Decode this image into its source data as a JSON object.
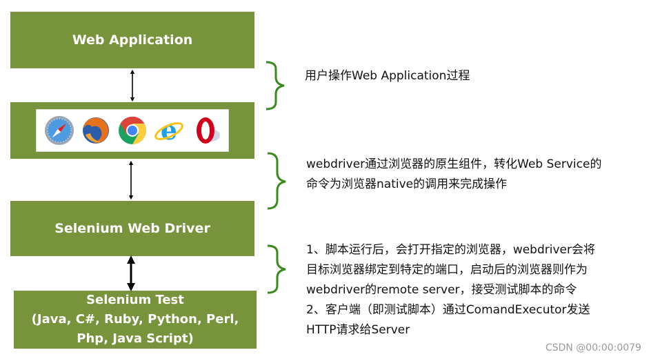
{
  "blocks": {
    "web_application": "Web Application",
    "selenium_web_driver": "Selenium Web Driver",
    "selenium_test": [
      "Selenium Test",
      "(Java, C#, Ruby, Python, Perl,",
      "Php, Java Script)"
    ]
  },
  "browsers": [
    {
      "icon": "safari-icon",
      "color": "#3a7fc4"
    },
    {
      "icon": "firefox-icon",
      "color": "#e8721c"
    },
    {
      "icon": "chrome-icon",
      "color": "#db4437"
    },
    {
      "icon": "internet-explorer-icon",
      "color": "#1fa0e2"
    },
    {
      "icon": "opera-icon",
      "color": "#d0021b"
    }
  ],
  "descriptions": {
    "user_operation": "用户操作Web Application过程",
    "webdriver_native": [
      "webdriver通过浏览器的原生组件，转化Web Service的",
      "命令为浏览器native的调用来完成操作"
    ],
    "test_flow": [
      "1、脚本运行后，会打开指定的浏览器，webdriver会将",
      "目标浏览器绑定到特定的端口，启动后的浏览器则作为",
      "webdriver的remote server，接受测试脚本的命令",
      "2、客户端（即测试脚本）通过ComandExecutor发送",
      "HTTP请求给Server"
    ]
  },
  "watermark": "CSDN @00:00:0079",
  "colors": {
    "block_green": "#77933c",
    "brace_green": "#3a8a1e",
    "arrow": "#000000"
  }
}
